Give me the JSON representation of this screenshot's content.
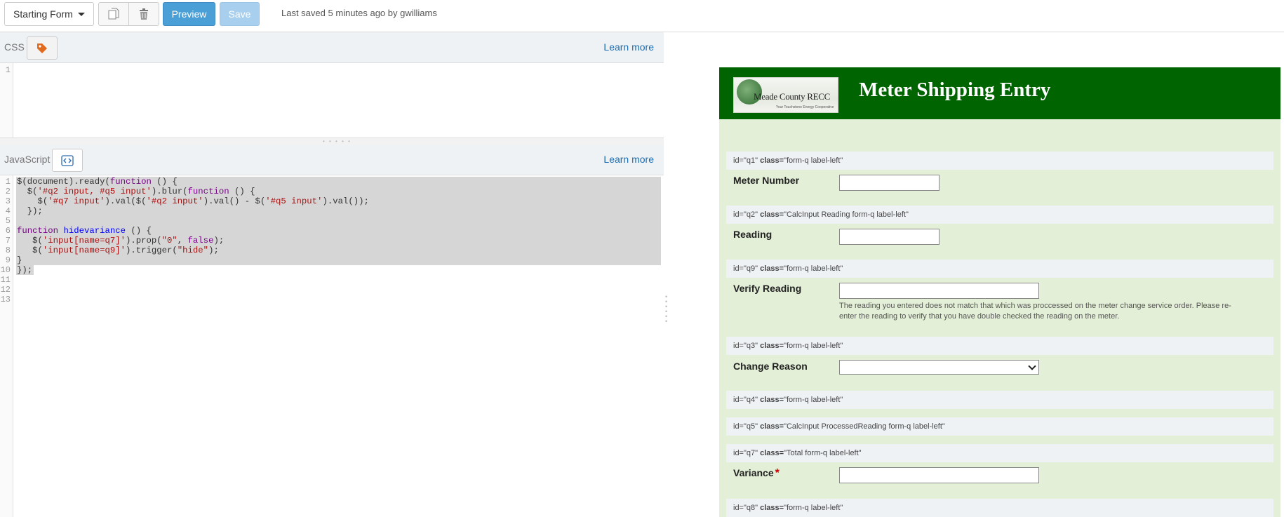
{
  "toolbar": {
    "form_select_value": "Starting Form",
    "copy_icon": "copy-icon",
    "delete_icon": "trash-icon",
    "preview_label": "Preview",
    "save_label": "Save",
    "status": "Last saved 5 minutes ago by gwilliams"
  },
  "css_panel": {
    "label": "CSS",
    "icon": "tag-icon",
    "learn_more": "Learn more",
    "lines": [
      "1"
    ]
  },
  "js_panel": {
    "label": "JavaScript",
    "icon": "code-icon",
    "learn_more": "Learn more",
    "line_numbers": [
      "1",
      "2",
      "3",
      "4",
      "5",
      "6",
      "7",
      "8",
      "9",
      "10",
      "11",
      "12",
      "13"
    ],
    "lines": [
      "$(document).ready(function () {",
      "  $('#q2 input, #q5 input').blur(function () {",
      "    $('#q7 input').val($('#q2 input').val() - $('#q5 input').val());",
      "  });",
      "",
      "function hidevariance () {",
      "   $('input[name=q7]').prop(\"0\", false);",
      "   $('input[name=q9]').trigger(\"hide\");",
      "}",
      "});",
      "",
      "",
      ""
    ]
  },
  "preview": {
    "logo_text": "Meade County RECC",
    "logo_tagline": "Your Touchstone Energy Cooperative",
    "title": "Meter Shipping Entry",
    "id_label": "id=",
    "class_label": "class=",
    "questions": [
      {
        "id": "\"q1\"",
        "cls": "\"form-q label-left\"",
        "label": "Meter Number"
      },
      {
        "id": "\"q2\"",
        "cls": "\"CalcInput Reading form-q label-left\"",
        "label": "Reading"
      },
      {
        "id": "\"q9\"",
        "cls": "\"form-q label-left\"",
        "label": "Verify Reading",
        "help": "The reading you entered does not match that which was proccessed on the meter change service order. Please re-enter the reading to verify that you have double checked the reading on the meter."
      },
      {
        "id": "\"q3\"",
        "cls": "\"form-q label-left\"",
        "label": "Change Reason",
        "select_value": ""
      },
      {
        "id": "\"q4\"",
        "cls": "\"form-q label-left\""
      },
      {
        "id": "\"q5\"",
        "cls": "\"CalcInput ProcessedReading form-q label-left\""
      },
      {
        "id": "\"q7\"",
        "cls": "\"Total form-q label-left\"",
        "label": "Variance",
        "required": "*"
      },
      {
        "id": "\"q8\"",
        "cls": "\"form-q label-left\""
      }
    ]
  },
  "colors": {
    "banner": "#006400",
    "form_bg": "#e3efd6",
    "preview_button": "#4a9fd6",
    "link": "#1b6db3"
  }
}
